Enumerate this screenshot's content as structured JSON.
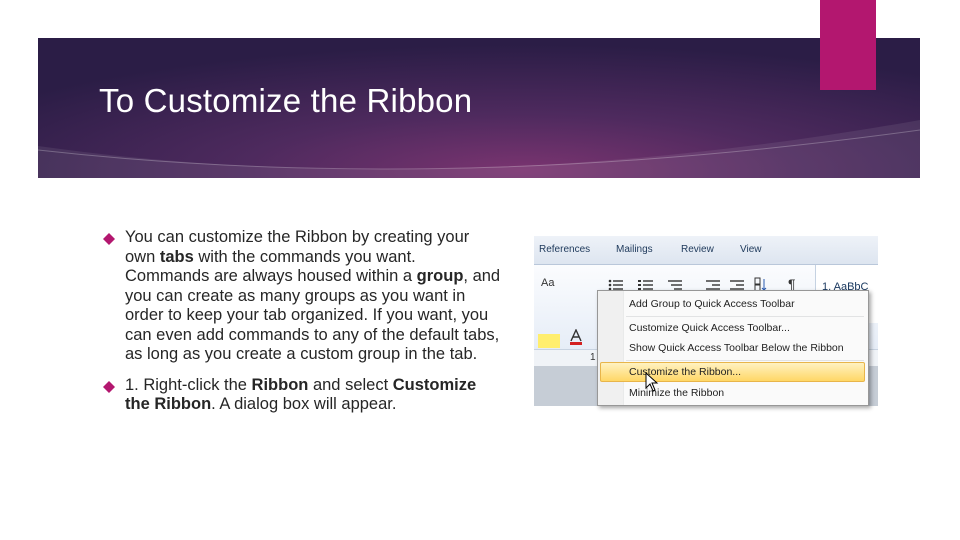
{
  "slide": {
    "title": "To Customize the Ribbon",
    "colors": {
      "banner": "#4e2a5e",
      "accent": "#b3176f",
      "bullet": "#b3176f"
    }
  },
  "bullets": [
    {
      "p1": "You can customize the Ribbon by creating your own ",
      "b1": "tabs",
      "p2": " with the commands you want. Commands are always housed within a ",
      "b2": "group",
      "p3": ", and you can create as many groups as you want in order to keep your tab organized. If you want, you can even add commands to any of the default tabs, as long as you create a custom group in the tab."
    },
    {
      "p1": "1. Right-click the ",
      "b1": "Ribbon",
      "p2": " and select ",
      "b2": "Customize the Ribbon",
      "p3": ". A dialog box will appear."
    }
  ],
  "screenshot": {
    "tabs": [
      "References",
      "Mailings",
      "Review",
      "View"
    ],
    "font_sample": "Aa",
    "pilcrow": "¶",
    "style_sample": "1. AaBbC",
    "ruler_mark": "1",
    "menu_items": [
      "Add Group to Quick Access Toolbar",
      "Customize Quick Access Toolbar...",
      "Show Quick Access Toolbar Below the Ribbon",
      "Customize the Ribbon...",
      "Minimize the Ribbon"
    ],
    "highlighted_item": "Customize the Ribbon..."
  }
}
